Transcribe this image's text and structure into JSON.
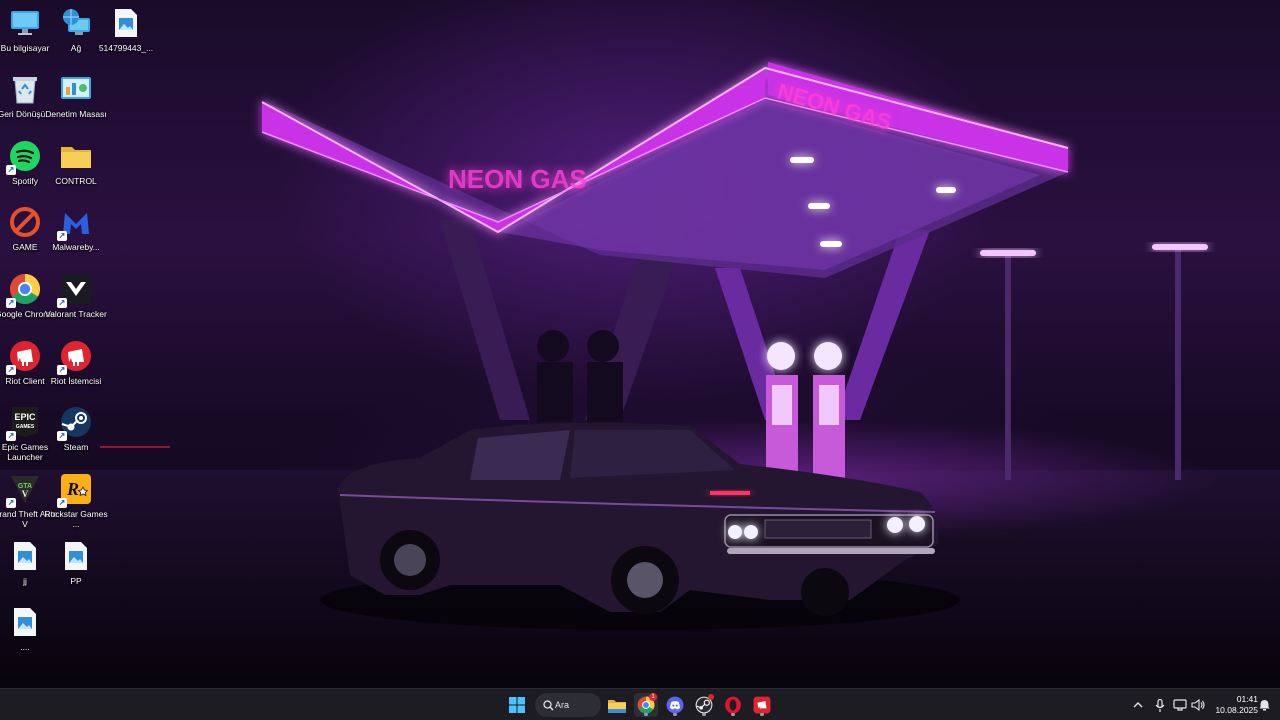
{
  "desktop": {
    "icons": [
      {
        "label": "Bu bilgisayar",
        "icon": "computer-icon"
      },
      {
        "label": "Ağ",
        "icon": "network-icon"
      },
      {
        "label": "514799443_...",
        "icon": "image-file-icon"
      },
      {
        "label": "Geri Dönüşü...",
        "icon": "recycle-bin-icon"
      },
      {
        "label": "Denetim Masası",
        "icon": "control-panel-icon"
      },
      {
        "label": "Spotify",
        "icon": "spotify-icon"
      },
      {
        "label": "CONTROL",
        "icon": "folder-icon"
      },
      {
        "label": "GAME",
        "icon": "game-icon"
      },
      {
        "label": "Malwareby...",
        "icon": "malwarebytes-icon"
      },
      {
        "label": "Google Chrome",
        "icon": "chrome-icon"
      },
      {
        "label": "Valorant Tracker",
        "icon": "valorant-tracker-icon"
      },
      {
        "label": "Riot Client",
        "icon": "riot-client-icon"
      },
      {
        "label": "Riot İstemcisi",
        "icon": "riot-client-icon"
      },
      {
        "label": "Epic Games Launcher",
        "icon": "epic-games-icon"
      },
      {
        "label": "Steam",
        "icon": "steam-icon"
      },
      {
        "label": "Grand Theft Auto V",
        "icon": "gta-v-icon"
      },
      {
        "label": "Rockstar Games ...",
        "icon": "rockstar-icon"
      },
      {
        "label": "jj",
        "icon": "image-file-icon"
      },
      {
        "label": "PP",
        "icon": "image-file-icon"
      },
      {
        "label": "....",
        "icon": "image-file-icon"
      }
    ]
  },
  "wallpaper": {
    "sign_text_left": "NEON GAS",
    "sign_text_right": "NEON GAS",
    "accent": "#d33cff"
  },
  "taskbar": {
    "search_label": "Ara",
    "apps": [
      {
        "name": "file-explorer",
        "icon": "folder-icon"
      },
      {
        "name": "chrome",
        "icon": "chrome-icon",
        "badge": "1"
      },
      {
        "name": "discord",
        "icon": "discord-icon"
      },
      {
        "name": "steam-notify",
        "icon": "steam-icon"
      },
      {
        "name": "opera",
        "icon": "opera-icon"
      },
      {
        "name": "riot-client",
        "icon": "riot-client-icon"
      }
    ],
    "clock_time": "01:41",
    "clock_date": "10.08.2025"
  },
  "colors": {
    "taskbar_bg": "#1c1c22",
    "neon_pink": "#e64bff",
    "neon_purple": "#8f3bff"
  }
}
